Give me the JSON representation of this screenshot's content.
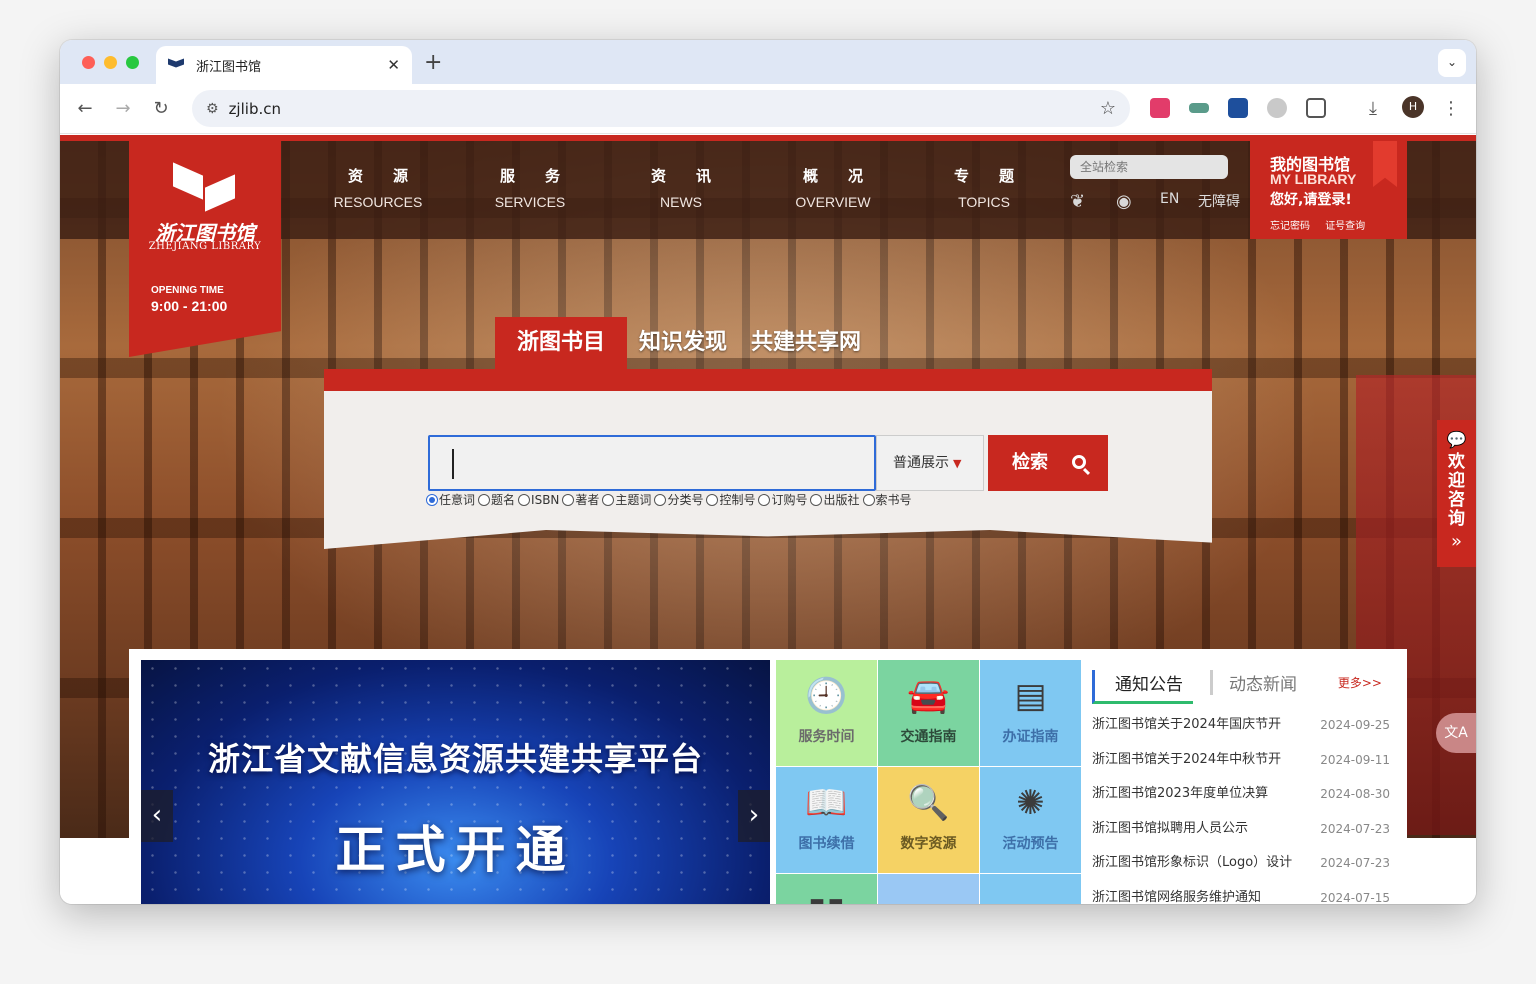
{
  "browser": {
    "tab_title": "浙江图书馆",
    "tab_close": "✕",
    "new_tab": "+",
    "tab_menu": "⌄",
    "url": "zjlib.cn",
    "profile_initial": "H"
  },
  "header": {
    "logo_cn": "浙江图书馆",
    "logo_en": "ZHEJIANG LIBRARY",
    "opening_label": "OPENING TIME",
    "opening_hours": "9:00 - 21:00",
    "menu": [
      {
        "cn": "资源",
        "en": "RESOURCES"
      },
      {
        "cn": "服务",
        "en": "SERVICES"
      },
      {
        "cn": "资讯",
        "en": "NEWS"
      },
      {
        "cn": "概况",
        "en": "OVERVIEW"
      },
      {
        "cn": "专题",
        "en": "TOPICS"
      }
    ],
    "site_search_placeholder": "全站检索",
    "lang_en": "EN",
    "accessibility": "无障碍",
    "my_library": {
      "title": "我的图书馆",
      "title_en": "MY LIBRARY",
      "greeting": "您好,请登录!",
      "forgot_password": "忘记密码",
      "card_query": "证号查询"
    }
  },
  "search": {
    "tabs": [
      "浙图书目",
      "知识发现",
      "共建共享网"
    ],
    "active_tab": 0,
    "query": "",
    "mode": "普通展示",
    "button": "检索",
    "fields": [
      "任意词",
      "题名",
      "ISBN",
      "著者",
      "主题词",
      "分类号",
      "控制号",
      "订购号",
      "出版社",
      "索书号"
    ],
    "selected_field": 0
  },
  "consult": {
    "label": "欢迎咨询"
  },
  "banner": {
    "title": "浙江省文献信息资源共建共享平台",
    "subtitle": "正式开通"
  },
  "tiles": [
    {
      "label": "服务时间",
      "icon": "clock-icon",
      "color": "#b9ef9c",
      "text_color": "#6b6b6b"
    },
    {
      "label": "交通指南",
      "icon": "car-icon",
      "color": "#7bd4a0",
      "text_color": "#2d4a3a"
    },
    {
      "label": "办证指南",
      "icon": "card-icon",
      "color": "#7fc8f2",
      "text_color": "#3d6fa8"
    },
    {
      "label": "图书续借",
      "icon": "book-icon",
      "color": "#7fc8f2",
      "text_color": "#3d6fa8"
    },
    {
      "label": "数字资源",
      "icon": "search-doc-icon",
      "color": "#f5d264",
      "text_color": "#6b5a22"
    },
    {
      "label": "活动预告",
      "icon": "event-icon",
      "color": "#7fc8f2",
      "text_color": "#3d6fa8"
    },
    {
      "label": "",
      "icon": "chart-icon",
      "color": "#7bd4a0",
      "text_color": "#2d4a3a"
    },
    {
      "label": "",
      "icon": "tile-icon",
      "color": "#9ac8f4",
      "text_color": "#3d6fa8"
    },
    {
      "label": "",
      "icon": "tile-icon",
      "color": "#7fc8f2",
      "text_color": "#3d6fa8"
    }
  ],
  "notices": {
    "tab_active": "通知公告",
    "tab_inactive": "动态新闻",
    "more": "更多>>",
    "items": [
      {
        "title": "浙江图书馆关于2024年国庆节开",
        "date": "2024-09-25"
      },
      {
        "title": "浙江图书馆关于2024年中秋节开",
        "date": "2024-09-11"
      },
      {
        "title": "浙江图书馆2023年度单位决算",
        "date": "2024-08-30"
      },
      {
        "title": "浙江图书馆拟聘用人员公示",
        "date": "2024-07-23"
      },
      {
        "title": "浙江图书馆形象标识（Logo）设计",
        "date": "2024-07-23"
      },
      {
        "title": "浙江图书馆网络服务维护通知",
        "date": "2024-07-15"
      }
    ]
  }
}
